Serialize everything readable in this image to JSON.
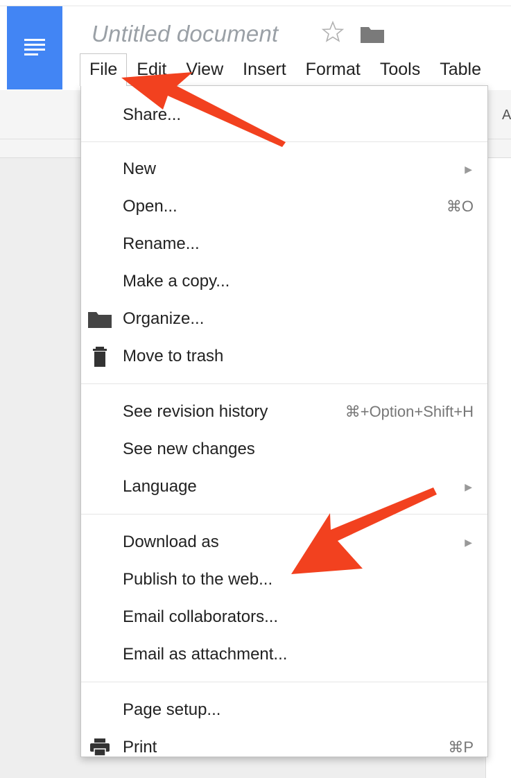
{
  "doc": {
    "title": "Untitled document"
  },
  "menubar": {
    "items": [
      "File",
      "Edit",
      "View",
      "Insert",
      "Format",
      "Tools",
      "Table"
    ],
    "active": "File"
  },
  "toolbar": {
    "fragment": "A"
  },
  "file_menu": {
    "groups": [
      [
        {
          "label": "Share..."
        }
      ],
      [
        {
          "label": "New",
          "submenu": true
        },
        {
          "label": "Open...",
          "shortcut": "⌘O"
        },
        {
          "label": "Rename..."
        },
        {
          "label": "Make a copy..."
        },
        {
          "label": "Organize...",
          "icon": "folder-icon"
        },
        {
          "label": "Move to trash",
          "icon": "trash-icon"
        }
      ],
      [
        {
          "label": "See revision history",
          "shortcut": "⌘+Option+Shift+H"
        },
        {
          "label": "See new changes"
        },
        {
          "label": "Language",
          "submenu": true
        }
      ],
      [
        {
          "label": "Download as",
          "submenu": true
        },
        {
          "label": "Publish to the web..."
        },
        {
          "label": "Email collaborators..."
        },
        {
          "label": "Email as attachment..."
        }
      ],
      [
        {
          "label": "Page setup..."
        },
        {
          "label": "Print",
          "icon": "print-icon",
          "shortcut": "⌘P"
        }
      ]
    ]
  },
  "icons": {
    "logo": "docs-lines-icon",
    "star": "star-icon",
    "folder": "folder-icon",
    "submenu": "submenu-arrow-icon"
  },
  "colors": {
    "brand_blue": "#4285f4",
    "annotation_red": "#f2411f"
  }
}
